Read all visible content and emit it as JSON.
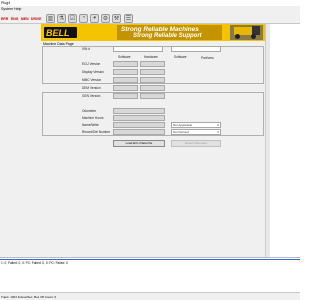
{
  "window": {
    "title": "Plug4"
  },
  "menu": {
    "items": [
      "System",
      "Help"
    ]
  },
  "toolbar": {
    "left_items": [
      "ERR",
      "ENG",
      "MEN",
      "DRIVE"
    ]
  },
  "banner": {
    "brand": "BELL",
    "slogan_line1": "Strong Reliable Machines",
    "slogan_line2": "Strong Reliable Support"
  },
  "section": {
    "title": "Machine Data Page"
  },
  "fields": {
    "vin_label": "VIN #",
    "col_software": "Software",
    "col_hardware": "Hardware",
    "right_col_software": "Software",
    "right_col_hardware": "Part/vers",
    "ecu_labels": [
      "ECU Version",
      "Display Version",
      "MMC Version",
      "DEM Version",
      "GEN Version"
    ],
    "odometer_label": "Odometer",
    "machine_hours_label": "Machine Hours",
    "name_write_label": "Name/Write",
    "record_write_label": "Record/Del Number",
    "select1_value": "Not Applicable",
    "select2_value": "Not Defined"
  },
  "buttons": {
    "load": "Load ECU Data File",
    "reset": "Reset Odometer"
  },
  "status_list": {
    "line": "1: 0, Failed: 0, 0: PC: Failed: 0, 0: PC: Failed: 0"
  },
  "status_bar": {
    "text": "Trans: 1023 Frame/Sec, Bus Off Count: 0"
  },
  "colors": {
    "banner": "#f4c400",
    "accent_red": "#c00000",
    "selection_blue": "#2a6fd6"
  }
}
